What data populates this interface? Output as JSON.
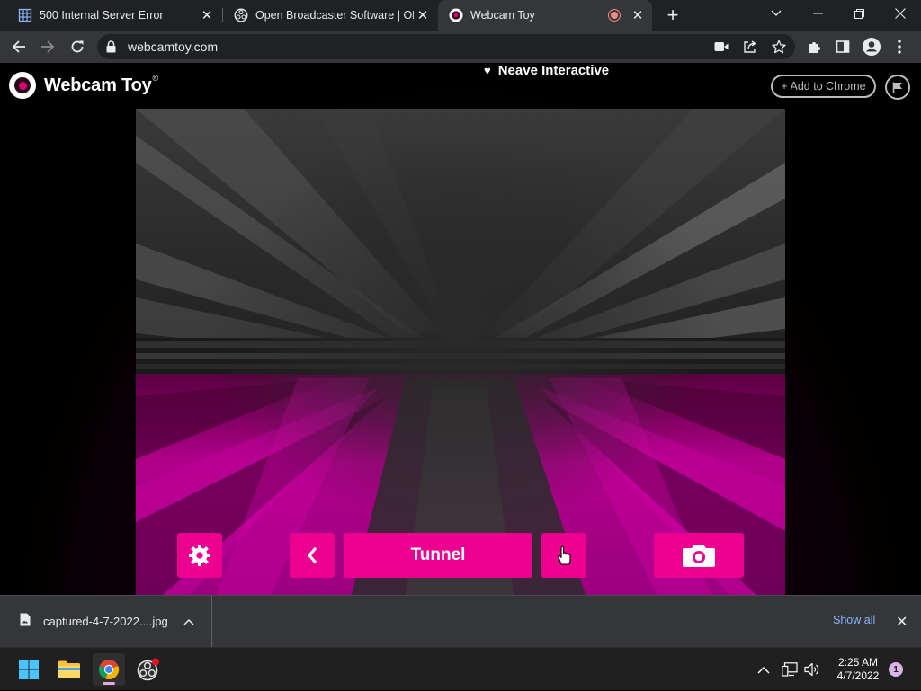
{
  "browser": {
    "tabs": [
      {
        "title": "500 Internal Server Error",
        "icon": "spreadsheet-icon"
      },
      {
        "title": "Open Broadcaster Software | OBS",
        "icon": "obs-icon"
      },
      {
        "title": "Webcam Toy",
        "icon": "webcam-toy-icon",
        "active": true
      }
    ],
    "url": "webcamtoy.com"
  },
  "page": {
    "logo_text": "Webcam Toy",
    "logo_mark": "®",
    "credit": "Neave Interactive",
    "add_to_chrome": "+ Add to Chrome",
    "effect_name": "Tunnel",
    "accent_color": "#ec0090"
  },
  "downloads": {
    "file_name": "captured-4-7-2022....jpg",
    "show_all": "Show all"
  },
  "taskbar": {
    "time": "2:25 AM",
    "date": "4/7/2022",
    "notification_count": "1"
  }
}
